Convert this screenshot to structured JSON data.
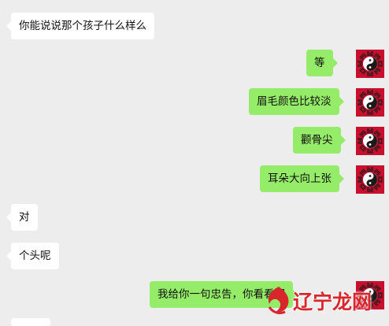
{
  "chat": {
    "messages": [
      {
        "side": "in",
        "text": "你能说说那个孩子什么样么"
      },
      {
        "side": "out",
        "text": "等"
      },
      {
        "side": "out",
        "text": "眉毛颜色比较淡"
      },
      {
        "side": "out",
        "text": "颧骨尖"
      },
      {
        "side": "out",
        "text": "耳朵大向上张"
      },
      {
        "side": "in",
        "text": "对"
      },
      {
        "side": "in",
        "text": "个头呢"
      },
      {
        "side": "out",
        "text": "我给你一句忠告，你看看吧"
      }
    ]
  },
  "watermark": {
    "text": "辽宁龙网"
  },
  "colors": {
    "background": "#ededed",
    "incoming_bubble": "#ffffff",
    "outgoing_bubble": "#95ec69",
    "avatar_red": "#c8102e",
    "watermark_red": "#d9262c"
  },
  "icons": {
    "avatar": "yin-yang-bagua-icon"
  }
}
